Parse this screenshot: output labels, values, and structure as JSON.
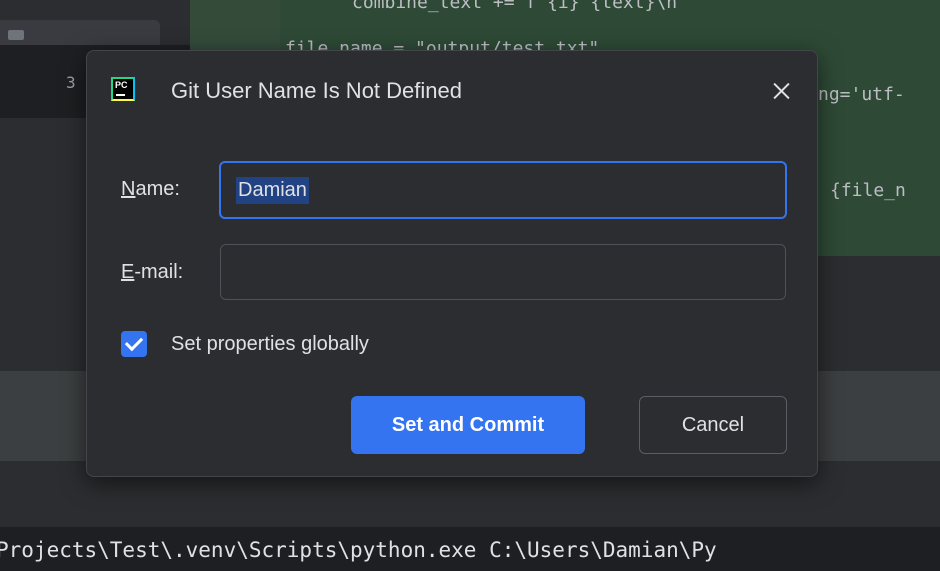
{
  "background": {
    "line_number": "3",
    "code_lines": [
      "combine_text += f\"{i} {text}\\n\"",
      "file_name = \"output/test.txt\"",
      "ng='utf-",
      "{file_n"
    ],
    "terminal_text": "Projects\\Test\\.venv\\Scripts\\python.exe C:\\Users\\Damian\\Py"
  },
  "dialog": {
    "app_icon_text": "PC",
    "title": "Git User Name Is Not Defined",
    "name_label_mnemonic": "N",
    "name_label_rest": "ame:",
    "name_value": "Damian",
    "email_label_mnemonic": "E",
    "email_label_rest": "-mail:",
    "email_value": "",
    "checkbox_checked": true,
    "checkbox_label": "Set properties globally",
    "primary_button": "Set and Commit",
    "cancel_button": "Cancel"
  },
  "colors": {
    "accent": "#3574f0",
    "dialog_bg": "#2b2d30",
    "diff_green": "#2e4a36",
    "text": "#dfe1e5"
  },
  "icons": {
    "app": "pycharm-icon",
    "close": "close-icon",
    "check": "checkmark-icon"
  }
}
